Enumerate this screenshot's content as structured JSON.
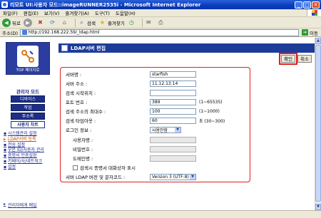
{
  "window": {
    "title": "리모트 UI:사용자 모드::imageRUNNER2535i - Microsoft Internet Explorer",
    "min_glyph": "_",
    "max_glyph": "□",
    "close_glyph": "✕"
  },
  "menu": [
    "파일(F)",
    "편집(E)",
    "보기(V)",
    "즐겨찾기(A)",
    "도구(T)",
    "도움말(H)"
  ],
  "toolbar": {
    "back_label": "뒤로",
    "search_label": "검색",
    "favorites_label": "즐겨찾기"
  },
  "address": {
    "label": "주소(D)",
    "url": "http://192.168.222.59/_ldap.html",
    "go_label": "이동"
  },
  "sidebar": {
    "logo_caption": "TOP 페이지로",
    "mode_title": "관리자 모드",
    "nav": [
      "디바이스",
      "작업",
      "주소록",
      "사용자 차트"
    ],
    "links": [
      {
        "label": "시스템관리 설정"
      },
      {
        "label": "LDAP서버 등록"
      },
      {
        "label": "전송 설정"
      },
      {
        "label": "부문 ID/사용자 관리"
      },
      {
        "label": "증명서 인증설정"
      },
      {
        "label": "키페어/사/네트워크"
      },
      {
        "label": "설정"
      }
    ],
    "back_link": "관리자에게 메일"
  },
  "page": {
    "title": "LDAP서버 편집",
    "ok_label": "확인",
    "cancel_label": "취소"
  },
  "form": {
    "server_name_label": "서버명 :",
    "server_name_value": "starfish",
    "server_addr_label": "서버 주소 :",
    "server_addr_value": "11.12.13.14",
    "search_start_label": "검색 시작위치 :",
    "search_start_value": "",
    "port_label": "포트 번호 :",
    "port_value": "389",
    "port_hint": "(1~65535)",
    "max_addr_label": "검색 주소의 최대수 :",
    "max_addr_value": "100",
    "max_addr_hint": "(1~1000)",
    "timeout_label": "검색 타임아웃 :",
    "timeout_value": "60",
    "timeout_hint": "초 (30~300)",
    "login_label": "로그인 정보 :",
    "login_value": "사용안함",
    "user_name_label": "사용자명 :",
    "password_label": "비밀번호 :",
    "domain_label": "도메인명 :",
    "auth_checkbox_label": "검색시 종명서 대화상자 표시",
    "ldap_version_label": "서버 LDAP 버전 및 문자코드 :",
    "ldap_version_value": "Version 3 (UTF-8)"
  }
}
